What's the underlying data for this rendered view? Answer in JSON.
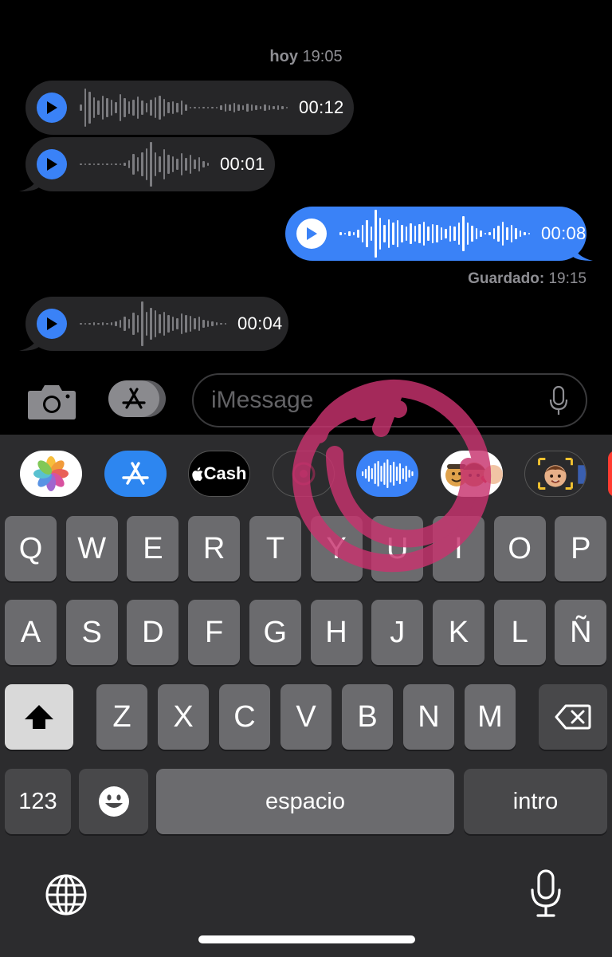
{
  "conversation": {
    "timestamp_day": "hoy",
    "timestamp_time": "19:05",
    "messages": [
      {
        "direction": "incoming",
        "duration": "00:12"
      },
      {
        "direction": "incoming",
        "duration": "00:01"
      },
      {
        "direction": "outgoing",
        "duration": "00:08"
      },
      {
        "direction": "incoming",
        "duration": "00:04"
      }
    ],
    "saved_label": "Guardado:",
    "saved_time": "19:15"
  },
  "input_bar": {
    "placeholder": "iMessage"
  },
  "app_drawer": {
    "apps": [
      {
        "name": "Fotos",
        "icon": "photos-icon"
      },
      {
        "name": "App Store",
        "icon": "app-store-icon"
      },
      {
        "name": "Cash",
        "label": "Cash",
        "icon": "apple-cash-icon"
      },
      {
        "name": "Digital Touch",
        "icon": "digital-touch-icon"
      },
      {
        "name": "Audio",
        "icon": "audio-waveform-icon"
      },
      {
        "name": "Memoji Stickers",
        "icon": "memoji-stickers-icon"
      },
      {
        "name": "Memoji",
        "icon": "memoji-icon"
      }
    ]
  },
  "keyboard": {
    "row1": [
      "Q",
      "W",
      "E",
      "R",
      "T",
      "Y",
      "U",
      "I",
      "O",
      "P"
    ],
    "row2": [
      "A",
      "S",
      "D",
      "F",
      "G",
      "H",
      "J",
      "K",
      "L",
      "Ñ"
    ],
    "row3": [
      "Z",
      "X",
      "C",
      "V",
      "B",
      "N",
      "M"
    ],
    "numbers_key": "123",
    "space_key": "espacio",
    "return_key": "intro"
  },
  "colors": {
    "accent": "#3a82f7",
    "incoming_bubble": "#262628",
    "keyboard_bg": "#2c2c2e",
    "key": "#6b6b6e",
    "annotation": "#c8336e"
  }
}
